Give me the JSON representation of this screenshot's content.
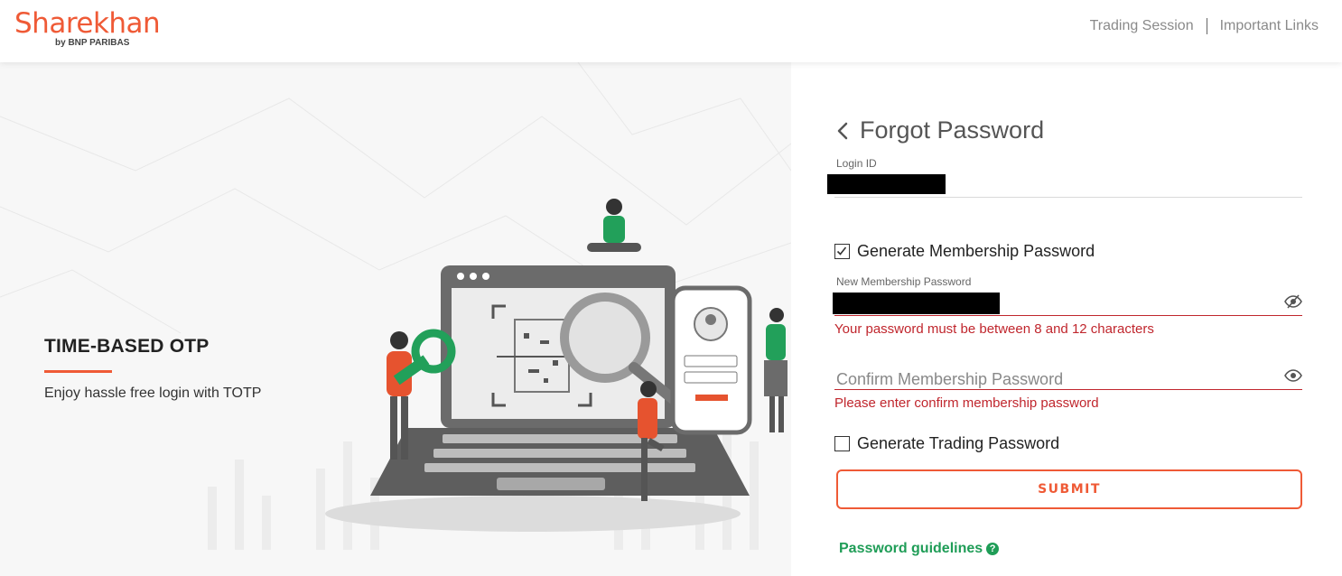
{
  "header": {
    "logo_text": "Sharekhan",
    "logo_sub": "by BNP PARIBAS",
    "links": [
      "Trading Session",
      "Important Links"
    ]
  },
  "promo": {
    "title": "TIME-BASED OTP",
    "subtitle": "Enjoy hassle free login with TOTP"
  },
  "form": {
    "title": "Forgot Password",
    "login_id_label": "Login ID",
    "generate_membership_label": "Generate Membership Password",
    "generate_membership_checked": true,
    "new_password_label": "New Membership Password",
    "new_password_error": "Your password must be between 8 and 12 characters",
    "confirm_password_placeholder": "Confirm Membership Password",
    "confirm_password_error": "Please enter confirm membership password",
    "generate_trading_label": "Generate Trading Password",
    "generate_trading_checked": false,
    "submit_label": "SUBMIT",
    "guidelines_label": "Password guidelines",
    "help_glyph": "?"
  },
  "colors": {
    "brand": "#ef5a36",
    "error": "#c0262d",
    "success": "#1f9d57"
  }
}
